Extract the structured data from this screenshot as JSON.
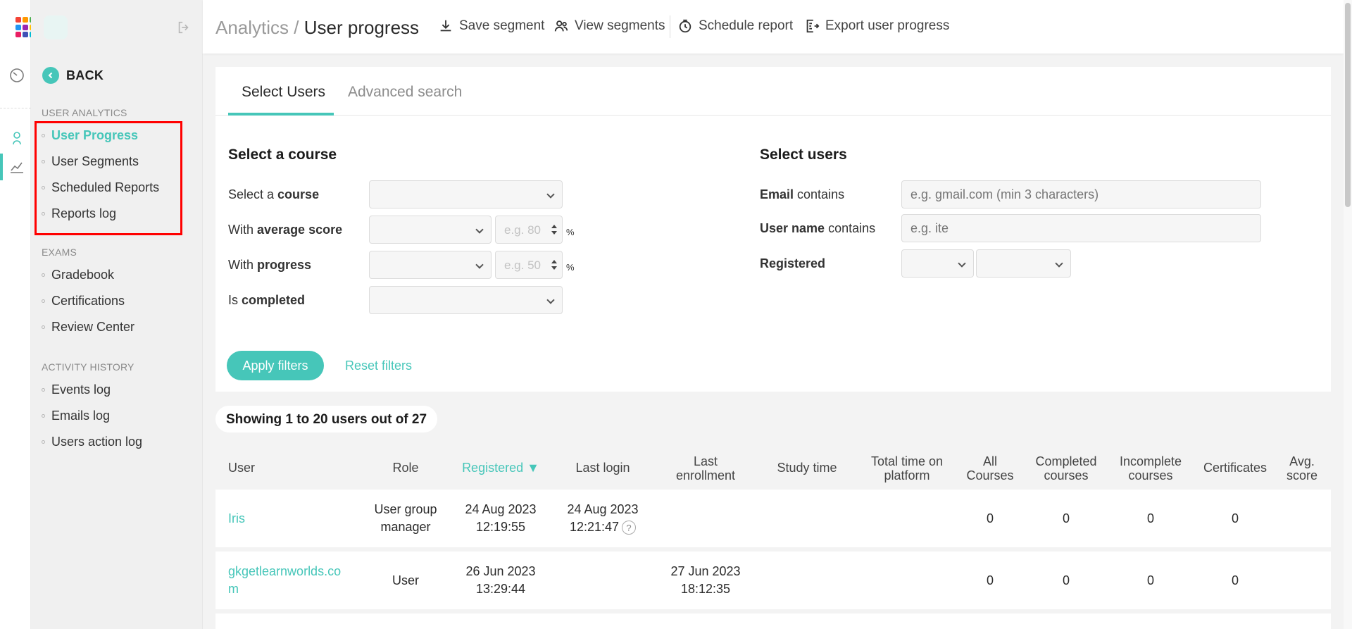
{
  "breadcrumb": {
    "section": "Analytics",
    "separator": "/",
    "page": "User progress"
  },
  "header_actions": [
    {
      "label": "Save segment",
      "icon": "download-icon"
    },
    {
      "label": "View segments",
      "icon": "users-icon"
    },
    {
      "label": "Schedule report",
      "icon": "clock-icon"
    },
    {
      "label": "Export user progress",
      "icon": "export-icon"
    }
  ],
  "sidebar": {
    "back_label": "BACK",
    "sections": [
      {
        "title": "USER ANALYTICS",
        "items": [
          "User Progress",
          "User Segments",
          "Scheduled Reports",
          "Reports log"
        ]
      },
      {
        "title": "EXAMS",
        "items": [
          "Gradebook",
          "Certifications",
          "Review Center"
        ]
      },
      {
        "title": "ACTIVITY HISTORY",
        "items": [
          "Events log",
          "Emails log",
          "Users action log"
        ]
      }
    ],
    "active_item": "User Progress"
  },
  "tabs": {
    "select_users": "Select Users",
    "advanced_search": "Advanced search"
  },
  "course_filters": {
    "title": "Select a course",
    "select_course": {
      "pre": "Select a ",
      "bold": "course"
    },
    "average_score": {
      "pre": "With ",
      "bold": "average score",
      "placeholder": "e.g. 80",
      "unit": "%"
    },
    "progress": {
      "pre": "With ",
      "bold": "progress",
      "placeholder": "e.g. 50",
      "unit": "%"
    },
    "completed": {
      "pre": "Is ",
      "bold": "completed"
    }
  },
  "user_filters": {
    "title": "Select users",
    "email": {
      "bold": "Email",
      "post": " contains",
      "placeholder": "e.g. gmail.com (min 3 characters)"
    },
    "username": {
      "bold": "User name",
      "post": " contains",
      "placeholder": "e.g. ite"
    },
    "registered": {
      "bold": "Registered"
    }
  },
  "buttons": {
    "apply": "Apply filters",
    "reset": "Reset filters"
  },
  "results": {
    "summary": "Showing 1 to 20 users out of 27"
  },
  "table": {
    "headers": {
      "user": "User",
      "role": "Role",
      "registered": "Registered ▼",
      "last_login": "Last login",
      "last_enrollment_1": "Last",
      "last_enrollment_2": "enrollment",
      "study_time": "Study time",
      "total_time_1": "Total time on",
      "total_time_2": "platform",
      "all_courses_1": "All",
      "all_courses_2": "Courses",
      "completed_1": "Completed",
      "completed_2": "courses",
      "incomplete_1": "Incomplete",
      "incomplete_2": "courses",
      "certificates": "Certificates",
      "avg_score_1": "Avg.",
      "avg_score_2": "score"
    },
    "rows": [
      {
        "user_1": "Iris",
        "user_2": "",
        "role_1": "User group",
        "role_2": "manager",
        "registered_1": "24 Aug 2023",
        "registered_2": "12:19:55",
        "last_login_1": "24 Aug 2023",
        "last_login_2": "12:21:47",
        "last_enrollment_1": "",
        "last_enrollment_2": "",
        "all_courses": "0",
        "completed": "0",
        "incomplete": "0",
        "certificates": "0"
      },
      {
        "user_1": "gkgetlearnworlds.co",
        "user_2": "m",
        "role_1": "User",
        "role_2": "",
        "registered_1": "26 Jun 2023",
        "registered_2": "13:29:44",
        "last_login_1": "",
        "last_login_2": "",
        "last_enrollment_1": "27 Jun 2023",
        "last_enrollment_2": "18:12:35",
        "all_courses": "0",
        "completed": "0",
        "incomplete": "0",
        "certificates": "0"
      }
    ]
  },
  "colors": {
    "accent": "#46c6b9",
    "highlight": "#ff0000"
  }
}
